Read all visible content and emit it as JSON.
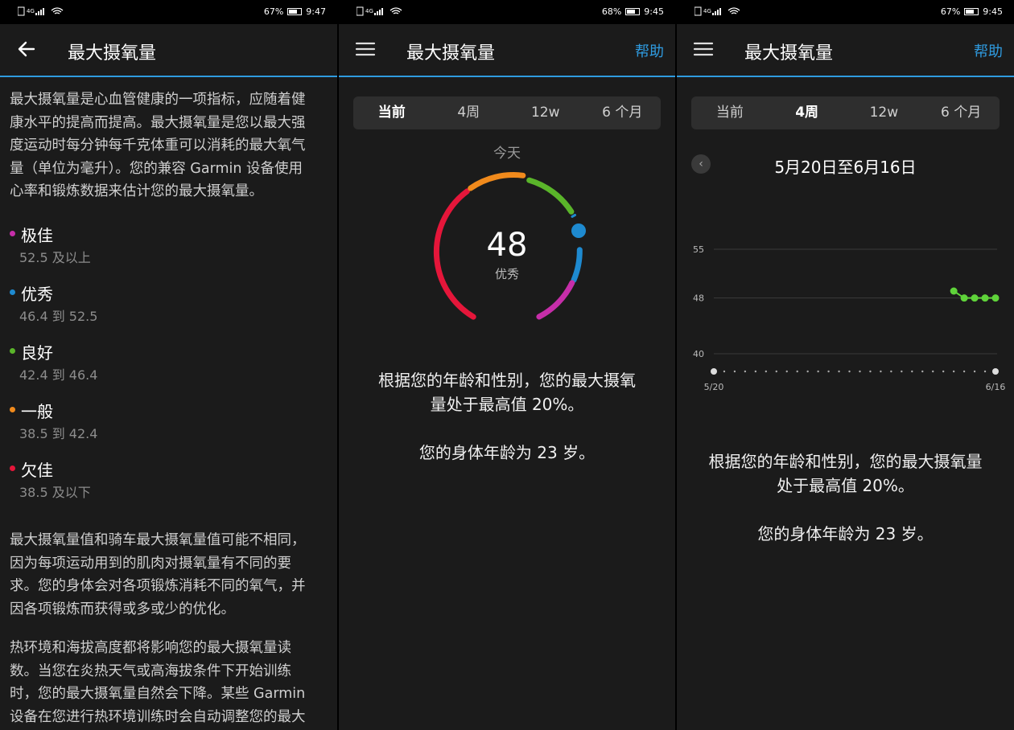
{
  "status": {
    "s1": {
      "battery": "67%",
      "time": "9:47"
    },
    "s2": {
      "battery": "68%",
      "time": "9:45"
    },
    "s3": {
      "battery": "67%",
      "time": "9:45"
    },
    "net": "4G"
  },
  "screen1": {
    "title": "最大摄氧量",
    "description": [
      "最大摄氧量是心血管健康的一项指标，应随着健",
      "康水平的提高而提高。最大摄氧量是您以最大强",
      "度运动时每分钟每千克体重可以消耗的最大氧气",
      "量（单位为毫升）。您的兼容 Garmin 设备使用",
      "心率和锻炼数据来估计您的最大摄氧量。"
    ],
    "categories": [
      {
        "name": "极佳",
        "range": "52.5 及以上",
        "color": "#c62ea9"
      },
      {
        "name": "优秀",
        "range": "46.4 到 52.5",
        "color": "#1e8ad0"
      },
      {
        "name": "良好",
        "range": "42.4 到 46.4",
        "color": "#5ab52a"
      },
      {
        "name": "一般",
        "range": "38.5 到 42.4",
        "color": "#f08a1c"
      },
      {
        "name": "欠佳",
        "range": "38.5 及以下",
        "color": "#e5163a"
      }
    ],
    "paragraph2": [
      "最大摄氧量值和骑车最大摄氧量值可能不相同，",
      "因为每项运动用到的肌肉对摄氧量有不同的要",
      "求。您的身体会对各项锻炼消耗不同的氧气，并",
      "因各项锻炼而获得或多或少的优化。"
    ],
    "paragraph3": [
      "热环境和海拔高度都将影响您的最大摄氧量读",
      "数。当您在炎热天气或高海拔条件下开始训练",
      "时，您的最大摄氧量自然会下降。某些 Garmin",
      "设备在您进行热环境训练时会自动调整您的最大"
    ]
  },
  "screen2": {
    "title": "最大摄氧量",
    "help": "帮助",
    "tabs": [
      "当前",
      "4周",
      "12w",
      "6 个月"
    ],
    "today": "今天",
    "value": "48",
    "rating": "优秀",
    "text1": [
      "根据您的年龄和性别，您的最大摄氧",
      "量处于最高值 20%。"
    ],
    "text2": "您的身体年龄为 23 岁。"
  },
  "screen3": {
    "title": "最大摄氧量",
    "help": "帮助",
    "tabs": [
      "当前",
      "4周",
      "12w",
      "6 个月"
    ],
    "range": "5月20日至6月16日",
    "text1": [
      "根据您的年龄和性别，您的最大摄氧量",
      "处于最高值 20%。"
    ],
    "text2": "您的身体年龄为 23 岁。"
  },
  "chart_data": {
    "type": "line",
    "y_ticks": [
      55,
      48,
      40
    ],
    "x_labels": [
      "5/20",
      "6/16"
    ],
    "series": [
      {
        "x": [
          "6/12",
          "6/13",
          "6/14",
          "6/15",
          "6/16"
        ],
        "values": [
          49,
          48,
          48,
          48,
          48
        ],
        "color": "#5fd33a"
      }
    ]
  }
}
